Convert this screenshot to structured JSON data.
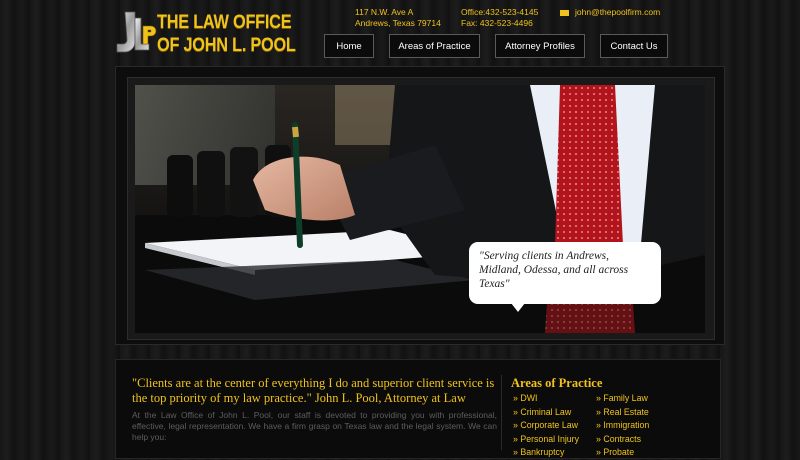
{
  "header": {
    "logo": {
      "monogram": "JLP",
      "line1": "THE LAW OFFICE",
      "line2": "OF JOHN L. POOL"
    },
    "address": {
      "line1": "117 N.W. Ave A",
      "line2": "Andrews, Texas 79714"
    },
    "phones": {
      "office": "Office:432-523-4145",
      "fax": "Fax: 432-523-4496"
    },
    "email": "john@thepoolfirm.com"
  },
  "nav": {
    "items": [
      {
        "label": "Home"
      },
      {
        "label": "Areas of Practice"
      },
      {
        "label": "Attorney Profiles"
      },
      {
        "label": "Contact Us"
      }
    ]
  },
  "hero": {
    "quote": "\"Serving clients in Andrews, Midland, Odessa, and all across Texas\""
  },
  "intro": {
    "quote": "\"Clients are at the center of everything I do and superior client service is the top priority of my law practice.\" John L. Pool, Attorney at Law",
    "body": "At the Law Office of John L. Pool, our staff is devoted to providing you with professional, effective, legal representation. We have a firm grasp on Texas law and the legal system. We can help you:"
  },
  "areas": {
    "title": "Areas of Practice",
    "col1": [
      "» DWI",
      "» Criminal Law",
      "» Corporate Law",
      "» Personal Injury",
      "» Bankruptcy"
    ],
    "col2": [
      "» Family Law",
      "» Real Estate",
      "» Immigration",
      "» Contracts",
      "» Probate"
    ]
  },
  "colors": {
    "accent": "#f0c21c",
    "background": "#141414",
    "nav_border": "#5a5a5a"
  }
}
